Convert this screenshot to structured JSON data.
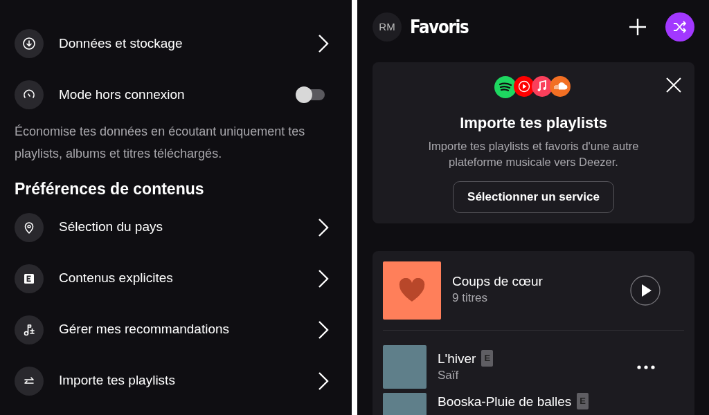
{
  "settings": {
    "items": [
      {
        "kind": "link",
        "label": "Données et stockage"
      },
      {
        "kind": "toggle",
        "label": "Mode hors connexion",
        "on": false
      }
    ],
    "description": "Économise tes données en écoutant uniquement tes playlists, albums et titres téléchargés.",
    "section_title": "Préférences de contenus",
    "section_items": [
      {
        "kind": "link",
        "label": "Sélection du pays"
      },
      {
        "kind": "link",
        "label": "Contenus explicites"
      },
      {
        "kind": "link",
        "label": "Gérer mes recommandations"
      },
      {
        "kind": "link",
        "label": "Importe tes playlists"
      }
    ]
  },
  "favorites": {
    "avatar": "RM",
    "title": "Favoris",
    "import_card": {
      "title": "Importe tes playlists",
      "description": "Importe tes playlists et favoris d'une autre plateforme musicale vers Deezer.",
      "button": "Sélectionner un service"
    },
    "playlist": {
      "title": "Coups de cœur",
      "count": "9 titres"
    },
    "tracks": [
      {
        "title": "L'hiver",
        "badge": "E",
        "artist": "Saïf"
      },
      {
        "title": "Booska-Pluie de balles",
        "badge": "E"
      }
    ]
  }
}
